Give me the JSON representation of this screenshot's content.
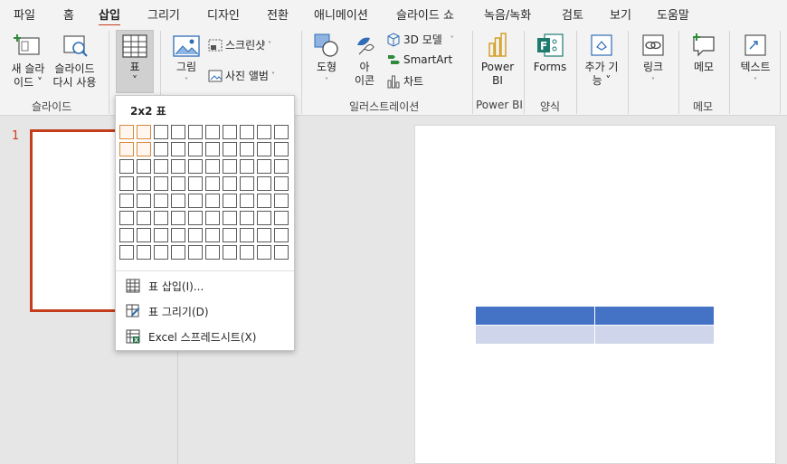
{
  "tabs": [
    "파일",
    "홈",
    "삽입",
    "그리기",
    "디자인",
    "전환",
    "애니메이션",
    "슬라이드 쇼",
    "녹음/녹화",
    "검토",
    "보기",
    "도움말"
  ],
  "active_tab": "삽입",
  "ribbon": {
    "slides": {
      "new_slide_l1": "새 슬라",
      "new_slide_l2": "이드 ˅",
      "reuse_l1": "슬라이드",
      "reuse_l2": "다시 사용",
      "label": "슬라이드"
    },
    "tables": {
      "table": "표",
      "chev": "˅"
    },
    "images": {
      "pictures": "그림",
      "screenshot": "스크린샷",
      "album": "사진 앨범"
    },
    "illustrations": {
      "shapes": "도형",
      "icons_l1": "아",
      "icons_l2": "이콘",
      "model3d": "3D 모델",
      "smartart": "SmartArt",
      "chart": "차트",
      "label": "일러스트레이션"
    },
    "powerbi": {
      "l1": "Power",
      "l2": "BI",
      "label": "Power BI"
    },
    "forms": {
      "btn": "Forms",
      "label": "양식"
    },
    "addins": {
      "l1": "추가 기",
      "l2": "능 ˅"
    },
    "links": {
      "btn": "링크"
    },
    "comments": {
      "btn": "메모",
      "label": "메모"
    },
    "text": {
      "btn": "텍스트"
    }
  },
  "thumbnail": {
    "slide_number": "1"
  },
  "dropdown": {
    "title": "2x2 표",
    "grid_cols": 10,
    "grid_rows": 8,
    "sel_cols": 2,
    "sel_rows": 2,
    "items": [
      {
        "label": "표 삽입(I)..."
      },
      {
        "label": "표 그리기(D)"
      },
      {
        "label": "Excel 스프레드시트(X)"
      }
    ]
  },
  "colors": {
    "accent": "#c43e1c",
    "table_header": "#4472c4",
    "table_row": "#cfd5ea",
    "grid_select": "#d68a3c"
  }
}
